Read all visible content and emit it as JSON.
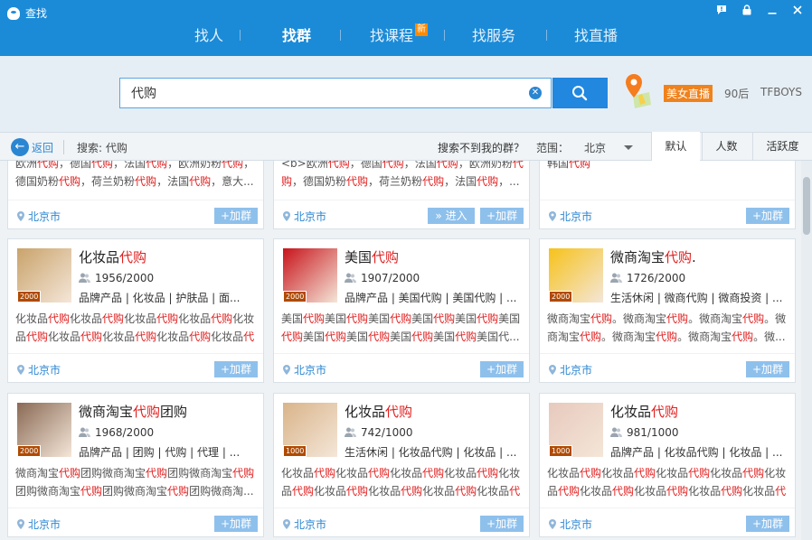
{
  "app": {
    "title": "查找"
  },
  "nav": [
    {
      "label": "找人",
      "active": false
    },
    {
      "label": "找群",
      "active": true
    },
    {
      "label": "找课程",
      "badge": "新",
      "active": false
    },
    {
      "label": "找服务",
      "active": false
    },
    {
      "label": "找直播",
      "active": false
    }
  ],
  "search": {
    "value": "代购",
    "hot_tag": "美女直播",
    "hot_terms": [
      "90后",
      "TFBOYS"
    ]
  },
  "filter": {
    "back_label": "返回",
    "search_prefix": "搜索: 代购",
    "not_found": "搜索不到我的群？",
    "range_label": "范围：",
    "range_value": "北京",
    "sort_tabs": [
      "默认",
      "人数",
      "活跃度"
    ],
    "active_sort": 0
  },
  "groups_top": [
    {
      "desc": "欧洲代购，德国代购，法国代购，欧洲奶粉代购，德国奶粉代购，荷兰奶粉代购，法国代购，意大...",
      "location": "北京市",
      "join": "+加群"
    },
    {
      "desc": "<b>欧洲代购，德国代购，法国代购，欧洲奶粉代购，德国奶粉代购，荷兰奶粉代购，法国代购，...",
      "location": "北京市",
      "join": "+加群",
      "enter": "» 进入"
    },
    {
      "desc": "韩国代购",
      "location": "北京市",
      "join": "+加群"
    }
  ],
  "groups": [
    {
      "name_pre": "化妆品",
      "name_hl": "代购",
      "name_post": "",
      "count": "1956/2000",
      "tags": "品牌产品 | 化妆品 | 护肤品 | 面...",
      "desc": "化妆品代购化妆品代购化妆品代购化妆品代购化妆品代购化妆品代购化妆品代购化妆品代购化妆品代购化妆品...",
      "location": "北京市",
      "join": "+加群",
      "level": "2000",
      "avatar_color": "#c9a36b"
    },
    {
      "name_pre": "美国",
      "name_hl": "代购",
      "name_post": "",
      "count": "1907/2000",
      "tags": "品牌产品 | 美国代购 | 美国代购 | ...",
      "desc": "美国代购美国代购美国代购美国代购美国代购美国代购美国代购美国代购美国代购美国代购美国代...",
      "location": "北京市",
      "join": "+加群",
      "level": "2000",
      "avatar_color": "#c8141b"
    },
    {
      "name_pre": "微商淘宝",
      "name_hl": "代购",
      "name_post": ".",
      "count": "1726/2000",
      "tags": "生活休闲 | 微商代购 | 微商投资 | ...",
      "desc": "微商淘宝代购。微商淘宝代购。微商淘宝代购。微商淘宝代购。微商淘宝代购。微商淘宝代购。微...",
      "location": "北京市",
      "join": "+加群",
      "level": "2000",
      "avatar_color": "#f6c21a"
    },
    {
      "name_pre": "微商淘宝",
      "name_hl": "代购",
      "name_post": "团购",
      "count": "1968/2000",
      "tags": "品牌产品 | 团购 | 代购 | 代理 | ...",
      "desc": "微商淘宝代购团购微商淘宝代购团购微商淘宝代购团购微商淘宝代购团购微商淘宝代购团购微商淘...",
      "location": "北京市",
      "join": "+加群",
      "level": "2000",
      "avatar_color": "#8a6a55"
    },
    {
      "name_pre": "化妆品",
      "name_hl": "代购",
      "name_post": "",
      "count": "742/1000",
      "tags": "生活休闲 | 化妆品代购 | 化妆品 | ...",
      "desc": "化妆品代购化妆品代购化妆品代购化妆品代购化妆品代购化妆品代购化妆品代购化妆品代购化妆品代购化妆...",
      "location": "北京市",
      "join": "+加群",
      "level": "1000",
      "avatar_color": "#d9b48a"
    },
    {
      "name_pre": "化妆品",
      "name_hl": "代购",
      "name_post": "",
      "count": "981/1000",
      "tags": "品牌产品 | 化妆品代购 | 化妆品 | ...",
      "desc": "化妆品代购化妆品代购化妆品代购化妆品代购化妆品代购化妆品代购化妆品代购化妆品代购化妆品代购化妆...",
      "location": "北京市",
      "join": "+加群",
      "level": "1000",
      "avatar_color": "#e7c9bd"
    }
  ],
  "colors": {
    "titlebar": "#1b8bd8",
    "accent": "#2b86d2",
    "highlight": "#e02020",
    "hot": "#f0821c"
  }
}
